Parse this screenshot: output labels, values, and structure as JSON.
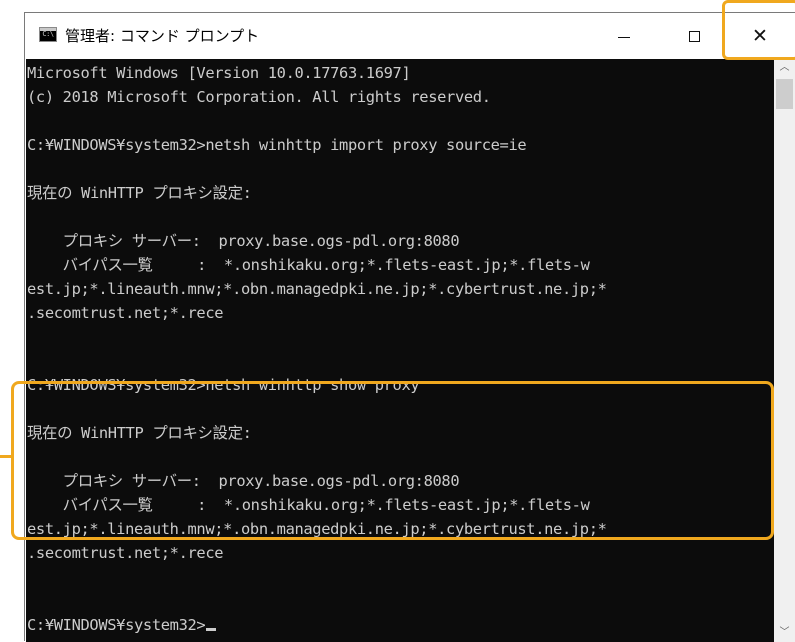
{
  "window": {
    "title": "管理者: コマンド プロンプト",
    "icon": "cmd-icon",
    "controls": {
      "minimize": "minimize",
      "maximize": "maximize",
      "close": "close"
    }
  },
  "console": {
    "lines": [
      "Microsoft Windows [Version 10.0.17763.1697]",
      "(c) 2018 Microsoft Corporation. All rights reserved.",
      "",
      "C:¥WINDOWS¥system32>netsh winhttp import proxy source=ie",
      "",
      "現在の WinHTTP プロキシ設定:",
      "",
      "    プロキシ サーバー:  proxy.base.ogs-pdl.org:8080",
      "    バイパス一覧     :  *.onshikaku.org;*.flets-east.jp;*.flets-w",
      "est.jp;*.lineauth.mnw;*.obn.managedpki.ne.jp;*.cybertrust.ne.jp;*",
      ".secomtrust.net;*.rece",
      "",
      "",
      "C:¥WINDOWS¥system32>netsh winhttp show proxy",
      "",
      "現在の WinHTTP プロキシ設定:",
      "",
      "    プロキシ サーバー:  proxy.base.ogs-pdl.org:8080",
      "    バイパス一覧     :  *.onshikaku.org;*.flets-east.jp;*.flets-w",
      "est.jp;*.lineauth.mnw;*.obn.managedpki.ne.jp;*.cybertrust.ne.jp;*",
      ".secomtrust.net;*.rece",
      "",
      "",
      "C:¥WINDOWS¥system32>"
    ]
  },
  "colors": {
    "console_bg": "#0c0c0c",
    "console_fg": "#cccccc",
    "highlight": "#f0a81e"
  }
}
